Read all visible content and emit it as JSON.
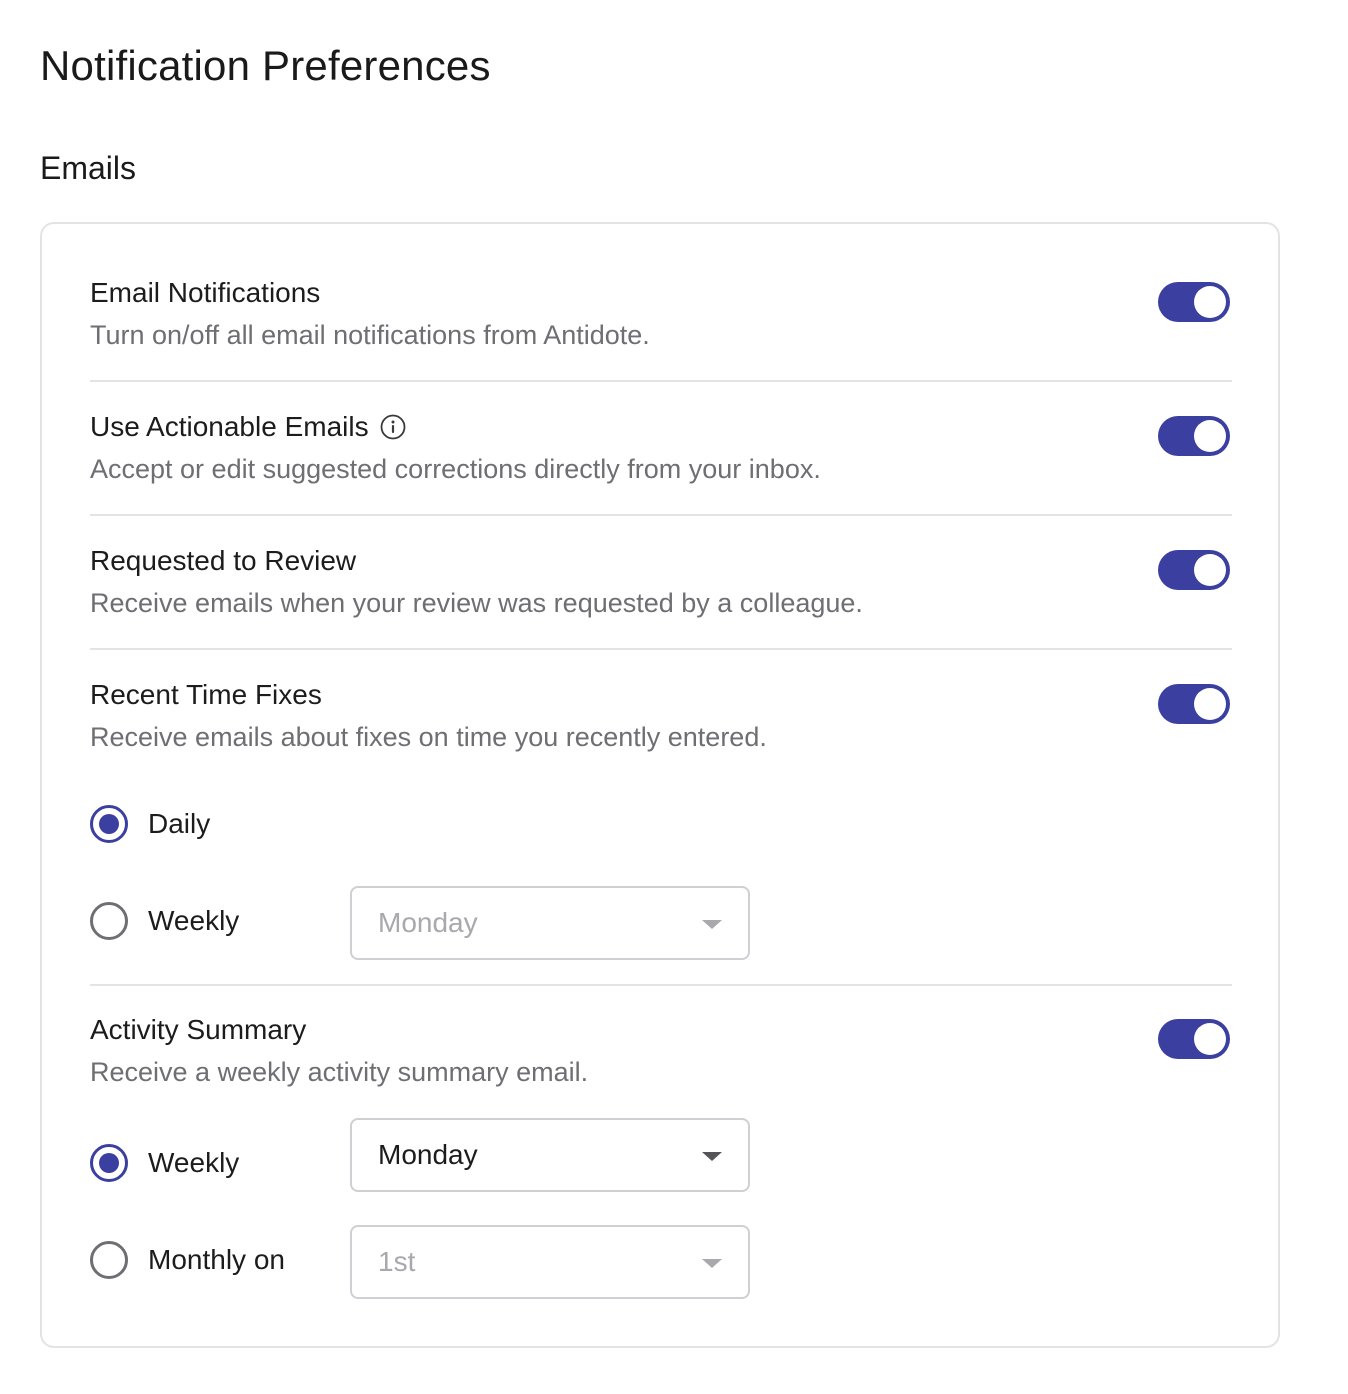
{
  "page": {
    "title": "Notification Preferences",
    "section_title": "Emails"
  },
  "colors": {
    "accent": "#3a3fa0",
    "border": "#e3e3e6",
    "muted_text": "#6e6e73"
  },
  "settings": [
    {
      "title": "Email Notifications",
      "description": "Turn on/off all email notifications from Antidote.",
      "enabled": true
    },
    {
      "title": "Use Actionable Emails",
      "description": "Accept or edit suggested corrections directly from your inbox.",
      "enabled": true,
      "icon": "info-icon"
    },
    {
      "title": "Requested to Review",
      "description": "Receive emails when your review was requested by a colleague.",
      "enabled": true
    },
    {
      "title": "Recent Time Fixes",
      "description": "Receive emails about fixes on time you recently entered.",
      "enabled": true,
      "frequency": {
        "options": [
          {
            "label": "Daily",
            "selected": true
          },
          {
            "label": "Weekly",
            "selected": false
          }
        ],
        "weekly_day": {
          "value": "Monday",
          "disabled": true
        }
      }
    },
    {
      "title": "Activity Summary",
      "description": "Receive a weekly activity summary email.",
      "enabled": true,
      "frequency": {
        "options": [
          {
            "label": "Weekly",
            "selected": true
          },
          {
            "label": "Monthly on",
            "selected": false
          }
        ],
        "weekly_day": {
          "value": "Monday",
          "disabled": false
        },
        "monthly_day": {
          "value": "1st",
          "disabled": true
        }
      }
    }
  ]
}
